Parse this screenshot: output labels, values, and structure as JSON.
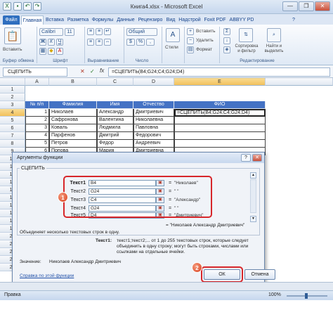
{
  "window": {
    "title": "Книга4.xlsx - Microsoft Excel",
    "buttons": {
      "minimize": "—",
      "restore": "❐",
      "close": "✕"
    }
  },
  "qat": {
    "save": "▪",
    "undo": "↶",
    "redo": "↷"
  },
  "ribbon": {
    "tabs": [
      "Файл",
      "Главная",
      "Вставка",
      "Разметка",
      "Формулы",
      "Данные",
      "Рецензиро",
      "Вид",
      "Надстрой",
      "Foxit PDF",
      "ABBYY PD"
    ],
    "groups": {
      "clipboard": {
        "label": "Буфер обмена",
        "paste": "Вставить"
      },
      "font": {
        "label": "Шрифт",
        "font_name": "Calibri",
        "font_size": "11"
      },
      "alignment": {
        "label": "Выравнивание"
      },
      "number": {
        "label": "Число",
        "format": "Общий"
      },
      "styles": {
        "label": "",
        "styles": "Стили"
      },
      "cells": {
        "label": "",
        "insert": "Вставить",
        "delete": "Удалить",
        "format": "Формат"
      },
      "editing": {
        "label": "Редактирование",
        "sort": "Сортировка и фильтр",
        "find": "Найти и выделить"
      }
    }
  },
  "formula_bar": {
    "name_box": "СЦЕПИТЬ",
    "cancel_icon": "✕",
    "enter_icon": "✓",
    "fx_label": "fx",
    "formula": "=СЦЕПИТЬ(B4;G24;C4;G24;D4)"
  },
  "grid": {
    "columns": [
      "A",
      "B",
      "C",
      "D",
      "E"
    ],
    "rows": [
      "1",
      "2",
      "3",
      "4",
      "5",
      "6",
      "7",
      "8",
      "9",
      "10",
      "11",
      "12",
      "13",
      "14",
      "15",
      "16",
      "17",
      "18",
      "19",
      "20",
      "21",
      "22",
      "23",
      "24"
    ],
    "table_headers": [
      "№ п/п",
      "Фамилия",
      "Имя",
      "Отчество",
      "ФИО"
    ],
    "table_rows": [
      [
        "1",
        "Николаев",
        "Александр",
        "Дмитриевич",
        "=СЦЕПИТЬ(B4;G24;C4;G24;D4)"
      ],
      [
        "2",
        "Сафронова",
        "Валентина",
        "Николаевна",
        ""
      ],
      [
        "3",
        "Коваль",
        "Людмила",
        "Павловна",
        ""
      ],
      [
        "4",
        "Парфенов",
        "Дмитрий",
        "Федорович",
        ""
      ],
      [
        "5",
        "Петров",
        "Федор",
        "Андреевич",
        ""
      ],
      [
        "6",
        "Попова",
        "Мария",
        "Дмитриевна",
        ""
      ]
    ]
  },
  "dialog": {
    "title": "Аргументы функции",
    "help_btn": "?",
    "close_btn": "✕",
    "function_name": "СЦЕПИТЬ",
    "args": [
      {
        "label": "Текст1",
        "value": "B4",
        "result": "\"Николаев\""
      },
      {
        "label": "Текст2",
        "value": "G24",
        "result": "\" \""
      },
      {
        "label": "Текст3",
        "value": "C4",
        "result": "\"Александр\""
      },
      {
        "label": "Текст4",
        "value": "G24",
        "result": "\" \""
      },
      {
        "label": "Текст5",
        "value": "D4",
        "result": "\"Дмитриевич\""
      }
    ],
    "eq": "=",
    "collapse_icon": "▣",
    "result_total": "= \"Николаев Александр Дмитриевич\"",
    "description": "Объединяет несколько текстовых строк в одну.",
    "arg_help_label": "Текст1:",
    "arg_help_text": "текст1;текст2;... от 1 до 255 текстовых строк, которые следует объединить в одну строку; могут быть строками, числами или ссылками на отдельные ячейки.",
    "value_label": "Значение:",
    "value": "Николаев Александр Дмитриевич",
    "help_link": "Справка по этой функции",
    "ok": "ОК",
    "cancel": "Отмена",
    "badges": [
      "1",
      "2"
    ]
  },
  "status": {
    "mode": "Правка",
    "zoom": "100%"
  },
  "colors": {
    "header_fill": "#4472c4",
    "highlight_red": "#d7262a",
    "badge_orange": "#d8401f"
  }
}
